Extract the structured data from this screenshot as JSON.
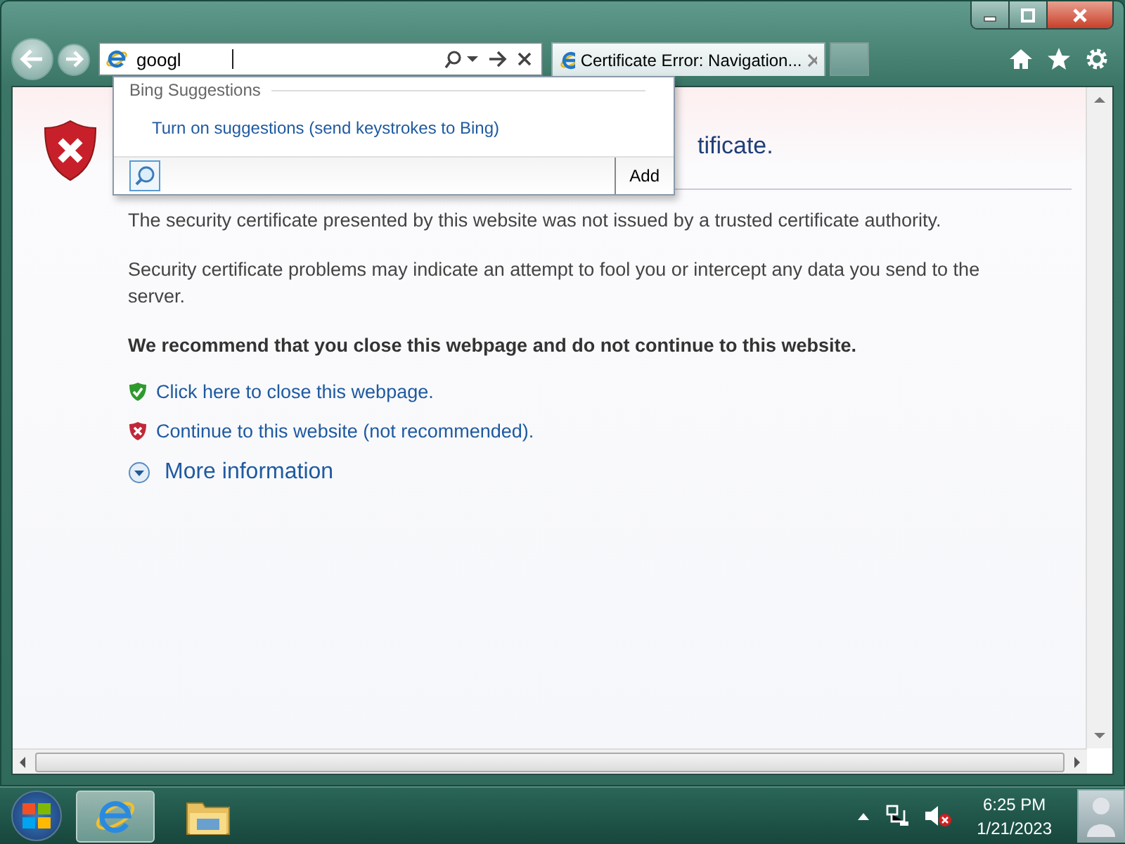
{
  "address_bar": {
    "value": "googl"
  },
  "tab": {
    "title": "Certificate Error: Navigation..."
  },
  "suggestions": {
    "header": "Bing Suggestions",
    "link": "Turn on suggestions (send keystrokes to Bing)",
    "add_button": "Add"
  },
  "page": {
    "heading": "tificate.",
    "paragraphs": [
      "The security certificate presented by this website was not issued by a trusted certificate authority.",
      "Security certificate problems may indicate an attempt to fool you or intercept any data you send to the server."
    ],
    "recommendation": "We recommend that you close this webpage and do not continue to this website.",
    "actions": [
      {
        "kind": "safe",
        "text": "Click here to close this webpage."
      },
      {
        "kind": "unsafe",
        "text": "Continue to this website (not recommended)."
      }
    ],
    "more_info": "More information"
  },
  "taskbar": {
    "time": "6:25 PM",
    "date": "1/21/2023"
  }
}
